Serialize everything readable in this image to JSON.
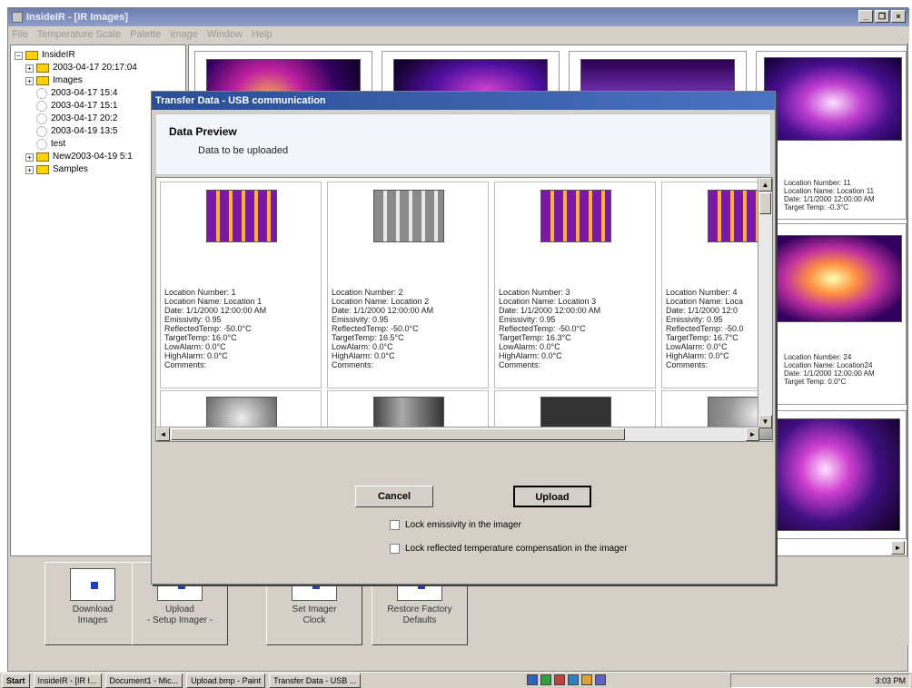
{
  "window": {
    "title": "InsideIR - [IR Images]",
    "controls": {
      "minimize": "_",
      "restore": "❐",
      "close": "×"
    }
  },
  "menubar": [
    "File",
    "Temperature Scale",
    "Palette",
    "Image",
    "Window",
    "Help"
  ],
  "tree": {
    "root": "InsideIR",
    "nodes": [
      {
        "label": "2003-04-17 20:17:04",
        "type": "folder",
        "indent": 1
      },
      {
        "label": "Images",
        "type": "folder",
        "indent": 1
      },
      {
        "label": "2003-04-17 15:4",
        "type": "image",
        "indent": 2
      },
      {
        "label": "2003-04-17 15:1",
        "type": "image",
        "indent": 2
      },
      {
        "label": "2003-04-17 20:2",
        "type": "image",
        "indent": 2
      },
      {
        "label": "2003-04-19 13:5",
        "type": "image",
        "indent": 2
      },
      {
        "label": "test",
        "type": "image",
        "indent": 2
      },
      {
        "label": "New2003-04-19 5:1",
        "type": "folder",
        "indent": 1
      },
      {
        "label": "Samples",
        "type": "folder",
        "indent": 1
      }
    ]
  },
  "gallery_captions": {
    "right1": [
      "Location Number: 11",
      "Location Name: Location 11",
      "Date: 1/1/2000 12:00:00 AM",
      "Target Temp: -0.3°C"
    ],
    "right2": [
      "Location Number: 24",
      "Location Name: Location24",
      "Date: 1/1/2000 12:00:00 AM",
      "Target Temp: 0.0°C"
    ]
  },
  "dialog": {
    "title": "Transfer Data - USB communication",
    "heading": "Data Preview",
    "subheading": "Data to be uploaded",
    "cancel": "Cancel",
    "upload": "Upload",
    "check1": "Lock emissivity in the imager",
    "check2": "Lock reflected temperature compensation in the imager",
    "cards": [
      {
        "lines": [
          "Location Number: 1",
          "Location Name: Location 1",
          "Date: 1/1/2000 12:00:00 AM",
          "Emissivity: 0.95",
          "ReflectedTemp: -50.0°C",
          "TargetTemp: 16.0°C",
          "LowAlarm: 0.0°C",
          "HighAlarm: 0.0°C",
          "Comments:"
        ]
      },
      {
        "lines": [
          "Location Number: 2",
          "Location Name: Location 2",
          "Date: 1/1/2000 12:00:00 AM",
          "Emissivity: 0.95",
          "ReflectedTemp: -50.0°C",
          "TargetTemp: 16.5°C",
          "LowAlarm: 0.0°C",
          "HighAlarm: 0.0°C",
          "Comments:"
        ]
      },
      {
        "lines": [
          "Location Number: 3",
          "Location Name: Location 3",
          "Date: 1/1/2000 12:00:00 AM",
          "Emissivity: 0.95",
          "ReflectedTemp: -50.0°C",
          "TargetTemp: 16.3°C",
          "LowAlarm: 0.0°C",
          "HighAlarm: 0.0°C",
          "Comments:"
        ]
      },
      {
        "lines": [
          "Location Number: 4",
          "Location Name: Loca",
          "Date: 1/1/2000 12:0",
          "Emissivity: 0.95",
          "ReflectedTemp: -50.0",
          "TargetTemp: 16.7°C",
          "LowAlarm: 0.0°C",
          "HighAlarm: 0.0°C",
          "Comments:"
        ]
      }
    ]
  },
  "bottom_buttons": [
    {
      "line1": "Download",
      "line2": "Images"
    },
    {
      "line1": "Upload",
      "line2": "- Setup Imager -"
    },
    {
      "line1": "Set Imager",
      "line2": "Clock"
    },
    {
      "line1": "Restore Factory",
      "line2": "Defaults"
    }
  ],
  "taskbar": {
    "start": "Start",
    "tasks": [
      "InsideIR - [IR I...",
      "Document1 - Mic...",
      "Upload.bmp - Paint",
      "Transfer Data - USB ..."
    ],
    "clock": "3:03 PM"
  }
}
